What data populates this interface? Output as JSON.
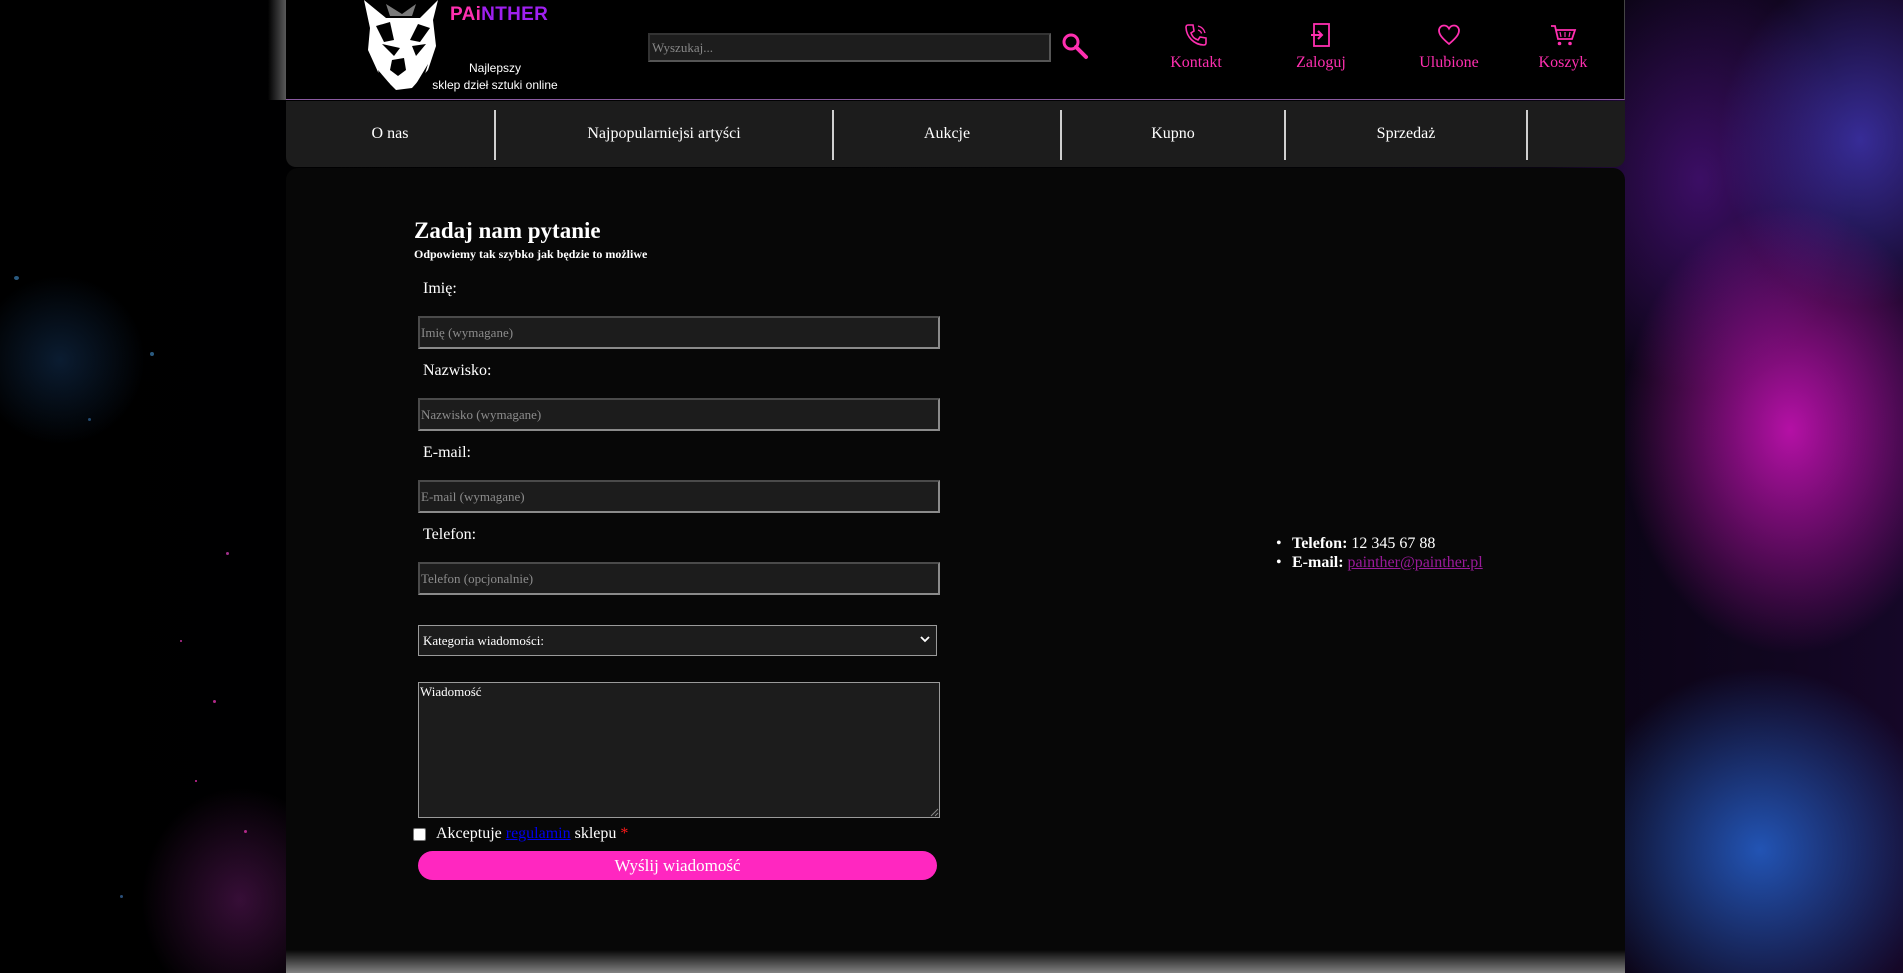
{
  "header": {
    "brand_prefix": "PAi",
    "brand_suffix": "NTHER",
    "tagline_line1": "Najlepszy",
    "tagline_line2": "sklep dzieł sztuki online",
    "search_placeholder": "Wyszukaj...",
    "nav": [
      {
        "label": "Kontakt",
        "icon": "phone-icon"
      },
      {
        "label": "Zaloguj",
        "icon": "login-icon"
      },
      {
        "label": "Ulubione",
        "icon": "heart-icon"
      },
      {
        "label": "Koszyk",
        "icon": "cart-icon"
      }
    ]
  },
  "menu": {
    "items": [
      "O nas",
      "Najpopularniejsi artyści",
      "Aukcje",
      "Kupno",
      "Sprzedaż"
    ]
  },
  "form": {
    "title": "Zadaj nam pytanie",
    "subtitle": "Odpowiemy tak szybko jak będzie to możliwe",
    "fields": [
      {
        "label": "Imię:",
        "placeholder": "Imię (wymagane)"
      },
      {
        "label": "Nazwisko:",
        "placeholder": "Nazwisko (wymagane)"
      },
      {
        "label": "E-mail:",
        "placeholder": "E-mail (wymagane)"
      },
      {
        "label": "Telefon:",
        "placeholder": "Telefon (opcjonalnie)"
      }
    ],
    "category_select": "Kategoria wiadomości:",
    "message_placeholder": "Wiadomość",
    "accept_prefix": "Akceptuje",
    "accept_link": "regulamin",
    "accept_suffix": "sklepu",
    "required_mark": "*",
    "submit_label": "Wyślij wiadomość"
  },
  "contact": {
    "phone_label": "Telefon:",
    "phone_value": "12 345 67 88",
    "email_label": "E-mail:",
    "email_value": "painther@painther.pl"
  },
  "colors": {
    "accent": "#ff27c0",
    "brand_purple": "#a020f0",
    "email_link": "#9a1a9a"
  }
}
